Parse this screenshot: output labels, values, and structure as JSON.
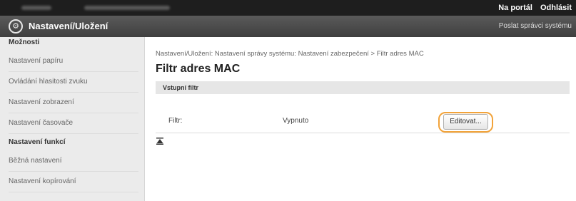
{
  "header": {
    "portal_link": "Na portál",
    "logout_link": "Odhlásit"
  },
  "titlebar": {
    "title": "Nastavení/Uložení",
    "manager_link": "Poslat správci systému"
  },
  "sidebar": {
    "preferences_heading": "Možnosti",
    "preferences_items": [
      {
        "label": "Nastavení papíru"
      },
      {
        "label": "Ovládání hlasitosti zvuku"
      },
      {
        "label": "Nastavení zobrazení"
      },
      {
        "label": "Nastavení časovače"
      }
    ],
    "function_heading": "Nastavení funkcí",
    "function_items": [
      {
        "label": "Běžná nastavení"
      },
      {
        "label": "Nastavení kopírování"
      }
    ]
  },
  "main": {
    "breadcrumb": "Nastavení/Uložení: Nastavení správy systému: Nastavení zabezpečení > Filtr adres MAC",
    "title": "Filtr adres MAC",
    "section_label": "Vstupní filtr",
    "edit_button": "Editovat...",
    "filter_label": "Filtr:",
    "filter_value": "Vypnuto"
  },
  "colors": {
    "topbar": "#1e1e1e",
    "highlight": "#f2a33a"
  }
}
